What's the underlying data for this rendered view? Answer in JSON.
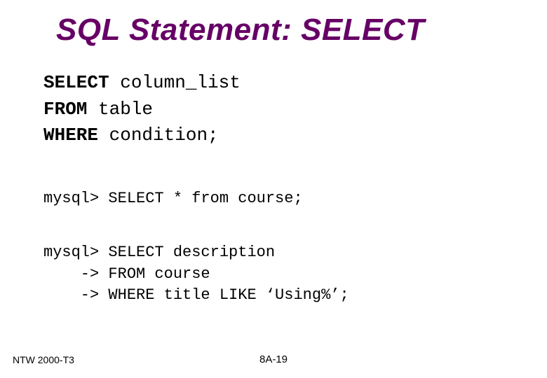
{
  "title": "SQL Statement: SELECT",
  "syntax": {
    "line1_kw": "SELECT",
    "line1_rest": " column_list",
    "line2_kw": "FROM",
    "line2_rest": " table",
    "line3_kw": "WHERE",
    "line3_rest": " condition;"
  },
  "example1": "mysql> SELECT * from course;",
  "example2": {
    "l1": "mysql> SELECT description",
    "l2": "    -> FROM course",
    "l3": "    -> WHERE title LIKE ‘Using%’;"
  },
  "footer": {
    "left": "NTW 2000-T3",
    "center": "8A-19"
  }
}
